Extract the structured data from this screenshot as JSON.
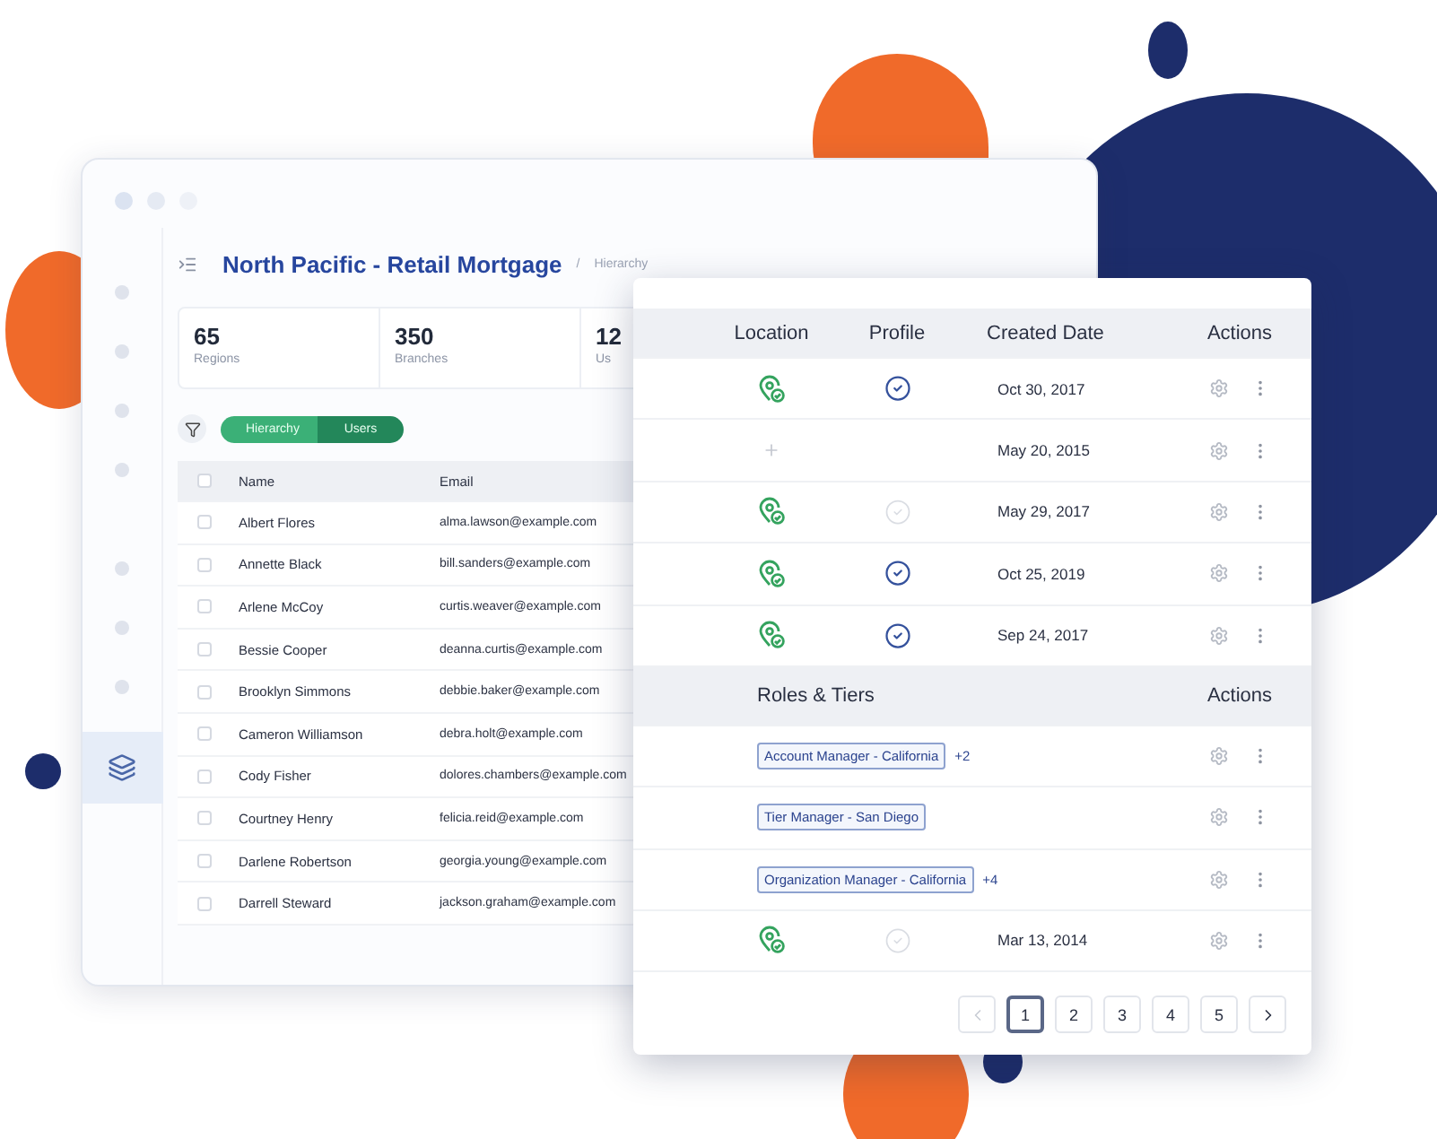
{
  "sidebar": [
    {
      "kind": "dot",
      "selected": false
    },
    {
      "kind": "dot",
      "selected": false
    },
    {
      "kind": "dot",
      "selected": false
    },
    {
      "kind": "dot",
      "selected": false
    },
    {
      "kind": "dot",
      "selected": false
    },
    {
      "kind": "dot",
      "selected": false
    },
    {
      "kind": "dot",
      "selected": false
    },
    {
      "kind": "layers",
      "selected": true
    }
  ],
  "header": {
    "title": "North Pacific - Retail Mortgage",
    "separator": "/",
    "breadcrumb": "Hierarchy"
  },
  "stats": [
    {
      "value": "65",
      "label": "Regions"
    },
    {
      "value": "350",
      "label": "Branches"
    },
    {
      "value": "12",
      "label": "Us"
    }
  ],
  "view_toggle": [
    {
      "label": "Hierarchy",
      "selected": false
    },
    {
      "label": "Users",
      "selected": true
    }
  ],
  "users_table": {
    "columns": [
      "Name",
      "Email"
    ],
    "header_checked": false,
    "rows": [
      {
        "name": "Albert Flores",
        "email": "alma.lawson@example.com",
        "checked": false
      },
      {
        "name": "Annette Black",
        "email": "bill.sanders@example.com",
        "checked": false
      },
      {
        "name": "Arlene McCoy",
        "email": "curtis.weaver@example.com",
        "checked": false
      },
      {
        "name": "Bessie Cooper",
        "email": "deanna.curtis@example.com",
        "checked": false
      },
      {
        "name": "Brooklyn Simmons",
        "email": "debbie.baker@example.com",
        "checked": false
      },
      {
        "name": "Cameron Williamson",
        "email": "debra.holt@example.com",
        "checked": false
      },
      {
        "name": "Cody Fisher",
        "email": "dolores.chambers@example.com",
        "checked": false
      },
      {
        "name": "Courtney Henry",
        "email": "felicia.reid@example.com",
        "checked": false
      },
      {
        "name": "Darlene Robertson",
        "email": "georgia.young@example.com",
        "checked": false
      },
      {
        "name": "Darrell Steward",
        "email": "jackson.graham@example.com",
        "checked": false
      }
    ]
  },
  "detail_panel": {
    "columns": [
      "Location",
      "Profile",
      "Created Date",
      "Actions"
    ],
    "rows": [
      {
        "location": {
          "kind": "pin"
        },
        "profile": {
          "kind": "verified"
        },
        "date": "Oct 30, 2017"
      },
      {
        "location": {
          "kind": "plus"
        },
        "profile": {
          "kind": "none"
        },
        "date": "May 20, 2015"
      },
      {
        "location": {
          "kind": "pin"
        },
        "profile": {
          "kind": "unverified"
        },
        "date": "May 29, 2017"
      },
      {
        "location": {
          "kind": "pin"
        },
        "profile": {
          "kind": "verified"
        },
        "date": "Oct 25, 2019"
      },
      {
        "location": {
          "kind": "pin"
        },
        "profile": {
          "kind": "verified"
        },
        "date": "Sep 24, 2017"
      }
    ],
    "roles_columns": [
      "Roles & Tiers",
      "Actions"
    ],
    "roles_rows": [
      {
        "kind": "role",
        "role": "Account Manager - California",
        "extra": "+2"
      },
      {
        "kind": "role",
        "role": "Tier Manager - San Diego"
      },
      {
        "kind": "role",
        "role": "Organization Manager  - California",
        "extra": "+4"
      },
      {
        "kind": "record",
        "location": {
          "kind": "pin"
        },
        "profile": {
          "kind": "unverified"
        },
        "date": "Mar 13, 2014"
      }
    ]
  },
  "pagination": {
    "prev_disabled": true,
    "pages": [
      {
        "label": "1",
        "selected": true
      },
      {
        "label": "2",
        "selected": false
      },
      {
        "label": "3",
        "selected": false
      },
      {
        "label": "4",
        "selected": false
      },
      {
        "label": "5",
        "selected": false
      }
    ]
  }
}
